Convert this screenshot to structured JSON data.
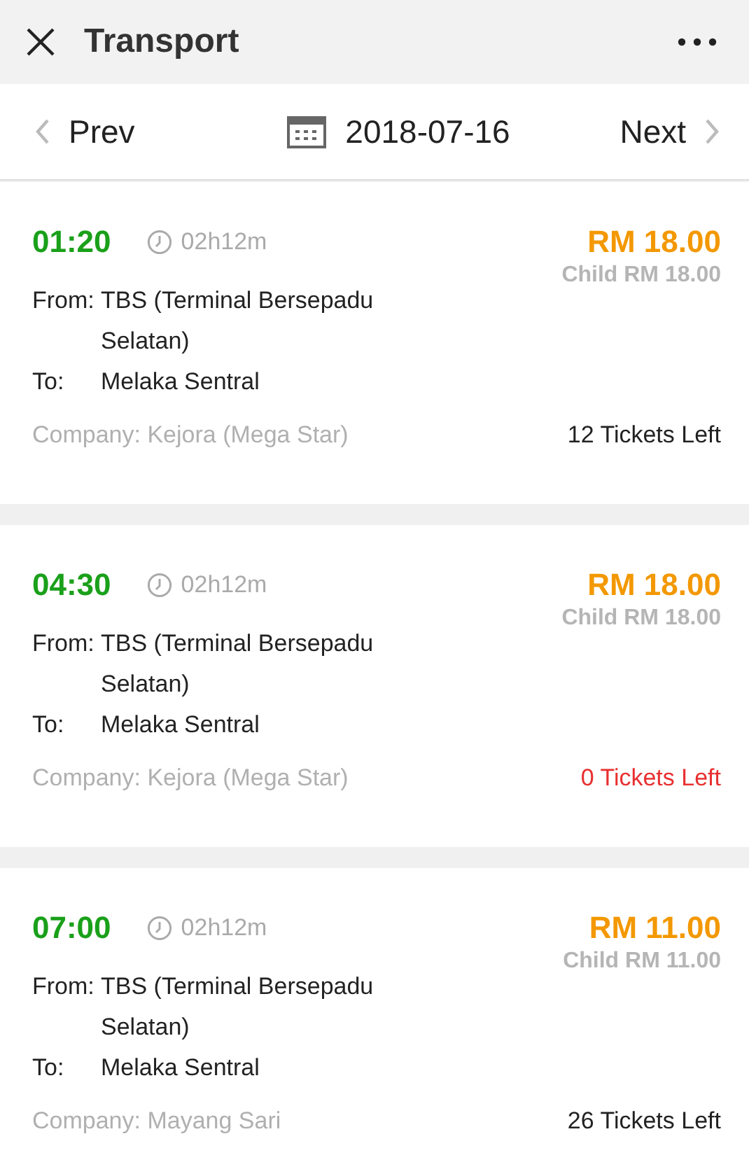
{
  "header": {
    "title": "Transport"
  },
  "date_bar": {
    "prev": "Prev",
    "date": "2018-07-16",
    "next": "Next"
  },
  "trips": [
    {
      "time": "01:20",
      "duration": "02h12m",
      "price": "RM 18.00",
      "child_price": "Child RM 18.00",
      "from_label": "From:",
      "from": "TBS (Terminal Bersepadu Selatan)",
      "to_label": "To:",
      "to": "Melaka Sentral",
      "company": "Company: Kejora (Mega Star)",
      "tickets": "12 Tickets Left",
      "sold_out": false
    },
    {
      "time": "04:30",
      "duration": "02h12m",
      "price": "RM 18.00",
      "child_price": "Child RM 18.00",
      "from_label": "From:",
      "from": "TBS (Terminal Bersepadu Selatan)",
      "to_label": "To:",
      "to": "Melaka Sentral",
      "company": "Company: Kejora (Mega Star)",
      "tickets": "0 Tickets Left",
      "sold_out": true
    },
    {
      "time": "07:00",
      "duration": "02h12m",
      "price": "RM 11.00",
      "child_price": "Child RM 11.00",
      "from_label": "From:",
      "from": "TBS (Terminal Bersepadu Selatan)",
      "to_label": "To:",
      "to": "Melaka Sentral",
      "company": "Company: Mayang Sari",
      "tickets": "26 Tickets Left",
      "sold_out": false
    }
  ]
}
